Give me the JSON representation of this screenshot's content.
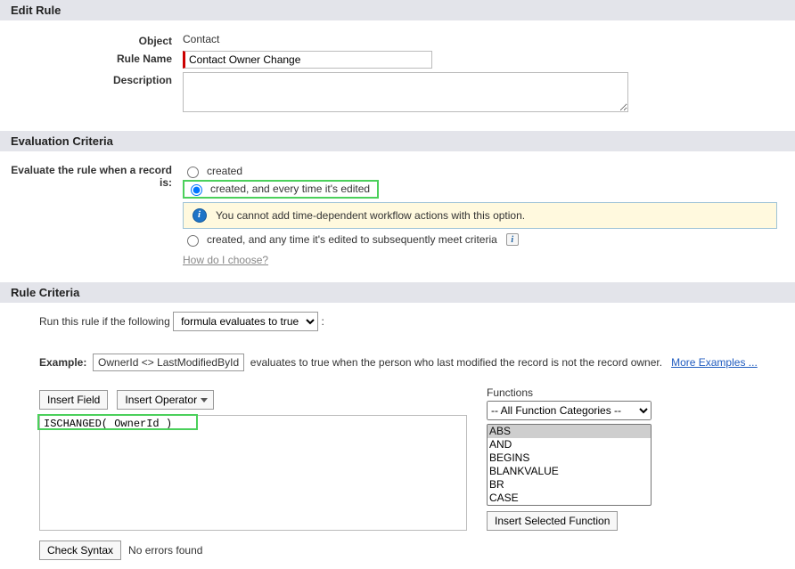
{
  "editRule": {
    "header": "Edit Rule",
    "labels": {
      "object": "Object",
      "ruleName": "Rule Name",
      "description": "Description"
    },
    "values": {
      "object": "Contact",
      "ruleName": "Contact Owner Change",
      "description": ""
    }
  },
  "evaluation": {
    "header": "Evaluation Criteria",
    "label": "Evaluate the rule when a record is:",
    "options": {
      "created": "created",
      "createdEdited": "created, and every time it's edited",
      "createdMeet": "created, and any time it's edited to subsequently meet criteria"
    },
    "selected": "createdEdited",
    "banner": "You cannot add time-dependent workflow actions with this option.",
    "helpLink": "How do I choose?"
  },
  "criteria": {
    "header": "Rule Criteria",
    "runText": "Run this rule if the following",
    "runSelectOptions": [
      "formula evaluates to true"
    ],
    "runSelected": "formula evaluates to true",
    "colon": ":",
    "exampleLabel": "Example:",
    "exampleBox": "OwnerId <> LastModifiedById",
    "exampleTail": "evaluates to true when the person who last modified the record is not the record owner.",
    "moreExamples": "More Examples ...",
    "buttons": {
      "insertField": "Insert Field",
      "insertOperator": "Insert Operator"
    },
    "formula": "ISCHANGED( OwnerId )",
    "functionsLabel": "Functions",
    "categoryOptions": [
      "-- All Function Categories --"
    ],
    "categorySelected": "-- All Function Categories --",
    "functionList": [
      "ABS",
      "AND",
      "BEGINS",
      "BLANKVALUE",
      "BR",
      "CASE"
    ],
    "insertSelected": "Insert Selected Function",
    "checkSyntax": "Check Syntax",
    "syntaxMsg": "No errors found"
  }
}
